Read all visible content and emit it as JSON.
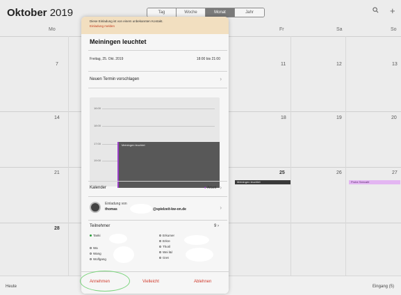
{
  "header": {
    "month": "Oktober",
    "year": "2019",
    "view_buttons": [
      "Tag",
      "Woche",
      "Monat",
      "Jahr"
    ],
    "active_view": "Monat",
    "search_icon": "search-icon",
    "add_icon": "plus-icon"
  },
  "weekdays": {
    "mo": "Mo",
    "fr": "Fr",
    "sa": "Sa",
    "so": "So"
  },
  "dates": {
    "r1_mo": "7",
    "r1_fr": "11",
    "r1_sa": "12",
    "r1_so": "13",
    "r2_mo": "14",
    "r2_fr": "18",
    "r2_sa": "19",
    "r2_so": "20",
    "r3_mo": "21",
    "r3_do": "25",
    "r3_sa": "26",
    "r3_so": "27",
    "r4_mo": "28"
  },
  "events": {
    "thursday_event": "Meiningen leuchtet",
    "sunday_event": "Probe Seecafé",
    "thursday_color": "#3a3a3a",
    "sunday_color": "#e3b6f2"
  },
  "footer": {
    "today": "Heute",
    "inbox": "Eingang (5)"
  },
  "popover": {
    "banner_line1": "Diese Einladung ist von einem unbekannten Kontakt.",
    "banner_line2": "Einladung melden",
    "title": "Meiningen leuchtet",
    "date": "Freitag, 25. Okt. 2019",
    "time": "18:00 bis 21:00",
    "propose": "Neuen Termin vorschlagen",
    "dayview": {
      "times": [
        "16:00",
        "18:00",
        "17:00",
        "19:00"
      ],
      "event_label": "Meiningen leuchtet"
    },
    "calendar_label": "Kalender",
    "calendar_value": "Arbeit",
    "calendar_color": "#9b3fc8",
    "invited_by_label": "Einladung von",
    "invited_by_name": "thomas",
    "invited_by_email": "@spielzeit-kw-on.de",
    "attendees_label": "Teilnehmer",
    "attendees_count": "9",
    "attendees_left": [
      "Tanki",
      "Wa",
      "Wang",
      "Wolfgang"
    ],
    "attendees_right": [
      "Erkumer",
      "Erkre",
      "Thoril",
      "Wei l&l",
      "Gret"
    ],
    "accept": "Annehmen",
    "maybe": "Vielleicht",
    "decline": "Ablehnen"
  }
}
